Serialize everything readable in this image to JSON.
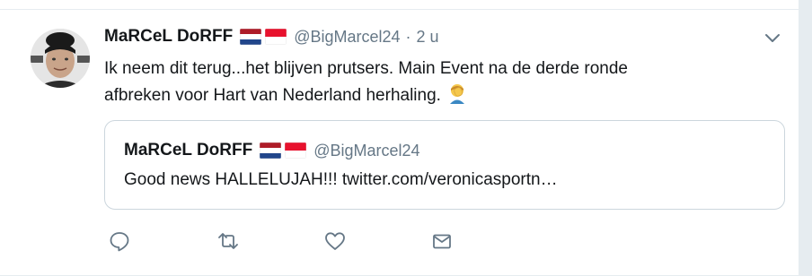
{
  "tweet": {
    "display_name": "MaRCeL DoRFF",
    "handle": "@BigMarcel24",
    "separator": "·",
    "time": "2 u",
    "text_line1": "Ik neem dit terug...het blijven prutsers. Main Event na de derde ronde",
    "text_line2": "afbreken voor Hart van Nederland herhaling.",
    "emoji": "man-facepalming-emoji"
  },
  "quoted_tweet": {
    "display_name": "MaRCeL DoRFF",
    "handle": "@BigMarcel24",
    "text": "Good news HALLELUJAH!!! twitter.com/veronicasportn…"
  },
  "icons": {
    "more": "chevron-down-icon",
    "reply": "reply-icon",
    "retweet": "retweet-icon",
    "like": "heart-icon",
    "dm": "envelope-icon"
  },
  "colors": {
    "text_primary": "#14171a",
    "text_secondary": "#657786",
    "border": "#ccd6dd",
    "background": "#e6ecf0"
  }
}
